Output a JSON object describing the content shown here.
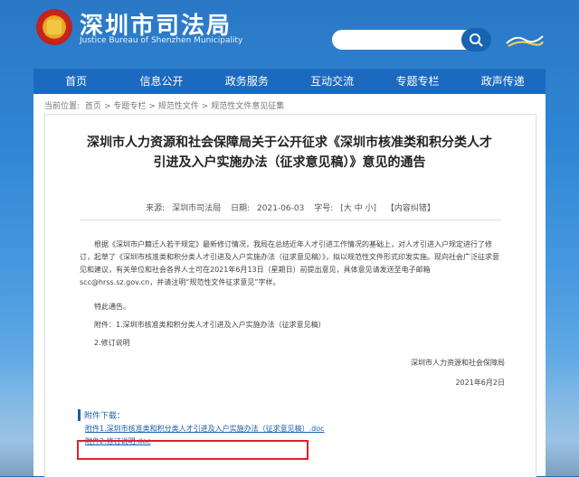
{
  "header": {
    "title": "深圳市司法局",
    "subtitle": "Justice Bureau of Shenzhen Municipality",
    "search_placeholder": ""
  },
  "nav": {
    "items": [
      "首页",
      "信息公开",
      "政务服务",
      "互动交流",
      "专题专栏",
      "政声传递"
    ]
  },
  "breadcrumb": {
    "label": "当前位置:",
    "items": [
      "首页",
      "专题专栏",
      "规范性文件",
      "规范性文件意见征集"
    ]
  },
  "article": {
    "title": "深圳市人力资源和社会保障局关于公开征求《深圳市核准类和积分类人才引进及入户实施办法（征求意见稿）》意见的通告",
    "source_label": "来源:",
    "source": "深圳市司法局",
    "date_label": "日期:",
    "date": "2021-06-03",
    "font_label": "字号:",
    "font_sizes": "[大 中 小]",
    "print_label": "【内容纠错】",
    "para1": "根据《深圳市户籍迁入若干规定》最新修订情况，我局在总结近年人才引进工作情况的基础上，对人才引进入户规定进行了修订，起草了《深圳市核准类和积分类人才引进及入户实施办法（征求意见稿）》，拟以规范性文件形式印发实施。现向社会广泛征求意见和建议，有关单位和社会各界人士可在2021年6月13日（星期日）前提出意见，具体意见请发送至电子邮箱scc@hrss.sz.gov.cn，并请注明“规范性文件征求意见”字样。",
    "para2": "特此通告。",
    "para3": "附件：1.深圳市核准类和积分类人才引进及入户实施办法（征求意见稿）",
    "para4": "2.修订说明",
    "sign_org": "深圳市人力资源和社会保障局",
    "sign_date": "2021年6月2日",
    "attach_head": "附件下载：",
    "attach1": "附件1.深圳市核准类和积分类人才引进及入户实施办法（征求意见稿）.doc",
    "attach2": "附件2.修订说明.doc"
  },
  "colors": {
    "accent": "#1b6abf",
    "highlight": "#e0202a"
  }
}
